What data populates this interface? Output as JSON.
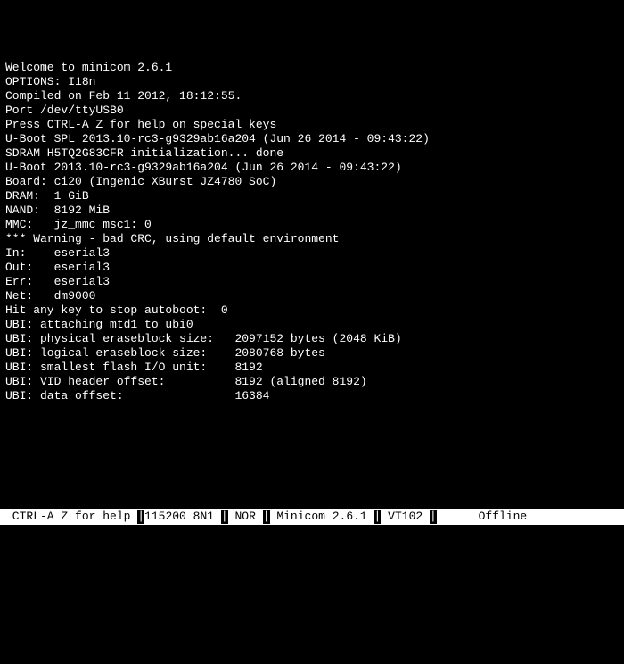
{
  "terminal": {
    "lines": [
      "Welcome to minicom 2.6.1",
      "",
      "OPTIONS: I18n",
      "Compiled on Feb 11 2012, 18:12:55.",
      "Port /dev/ttyUSB0",
      "",
      "Press CTRL-A Z for help on special keys",
      "",
      "",
      "U-Boot SPL 2013.10-rc3-g9329ab16a204 (Jun 26 2014 - 09:43:22)",
      "SDRAM H5TQ2G83CFR initialization... done",
      "",
      "",
      "U-Boot 2013.10-rc3-g9329ab16a204 (Jun 26 2014 - 09:43:22)",
      "",
      "Board: ci20 (Ingenic XBurst JZ4780 SoC)",
      "DRAM:  1 GiB",
      "NAND:  8192 MiB",
      "MMC:   jz_mmc msc1: 0",
      "*** Warning - bad CRC, using default environment",
      "",
      "In:    eserial3",
      "Out:   eserial3",
      "Err:   eserial3",
      "Net:   dm9000",
      "Hit any key to stop autoboot:  0",
      "UBI: attaching mtd1 to ubi0",
      "UBI: physical eraseblock size:   2097152 bytes (2048 KiB)",
      "UBI: logical eraseblock size:    2080768 bytes",
      "UBI: smallest flash I/O unit:    8192",
      "UBI: VID header offset:          8192 (aligned 8192)",
      "UBI: data offset:                16384"
    ]
  },
  "status": {
    "help": " CTRL-A Z for help ",
    "baud": "115200 8N1 ",
    "flow": " NOR ",
    "app": " Minicom 2.6.1 ",
    "term": " VT102 ",
    "spacer": "     ",
    "conn": " Offline"
  }
}
